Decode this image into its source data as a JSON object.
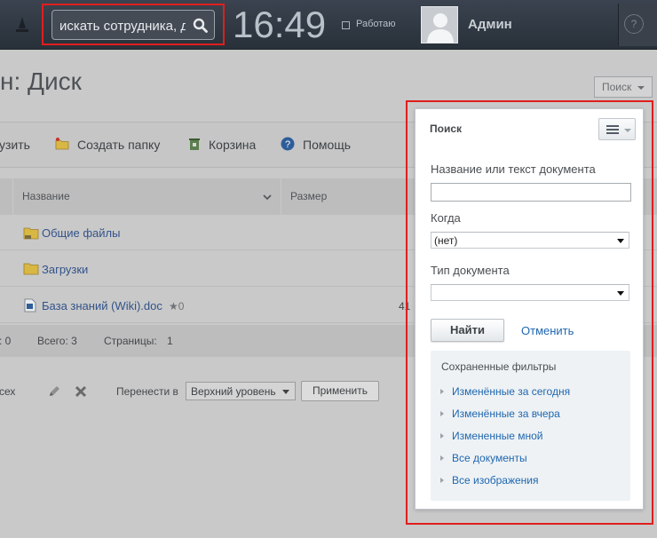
{
  "header": {
    "search_placeholder": "искать сотрудника, документ",
    "time": "16:49",
    "status_label": "Работаю",
    "user_name": "Админ",
    "help_label": "?"
  },
  "page": {
    "title": "н: Диск",
    "search_toggle_label": "Поиск"
  },
  "toolbar": {
    "upload_label": "узить",
    "create_folder_label": "Создать папку",
    "trash_label": "Корзина",
    "help_label": "Помощь"
  },
  "table": {
    "columns": [
      "Название",
      "Размер"
    ],
    "rows": [
      {
        "name": "Общие файлы",
        "type": "folder-shared",
        "size": ""
      },
      {
        "name": "Загрузки",
        "type": "folder",
        "size": ""
      },
      {
        "name": "База знаний (Wiki).doc",
        "type": "doc",
        "rating": "★0",
        "size": "41"
      }
    ]
  },
  "summary": {
    "selected": ": 0",
    "total": "Всего: 3",
    "pages": "Страницы:",
    "pages_value": "1"
  },
  "actions": {
    "select_all_label": "сех",
    "move_to_label": "Перенести в",
    "move_target": "Верхний уровень",
    "apply_label": "Применить"
  },
  "search_popup": {
    "title": "Поиск",
    "name_label": "Название или текст документа",
    "name_value": "",
    "when_label": "Когда",
    "when_value": "(нет)",
    "doc_type_label": "Тип документа",
    "doc_type_value": "",
    "find_button": "Найти",
    "cancel_link": "Отменить",
    "saved_filters_title": "Сохраненные фильтры",
    "saved_filters": [
      "Изменённые за сегодня",
      "Изменённые за вчера",
      "Измененные мной",
      "Все документы",
      "Все изображения"
    ]
  },
  "colors": {
    "header_bg": "#2f3640",
    "link": "#2067b0",
    "highlight": "#e01e1e",
    "overlay_bg": "#c9c9c9"
  }
}
